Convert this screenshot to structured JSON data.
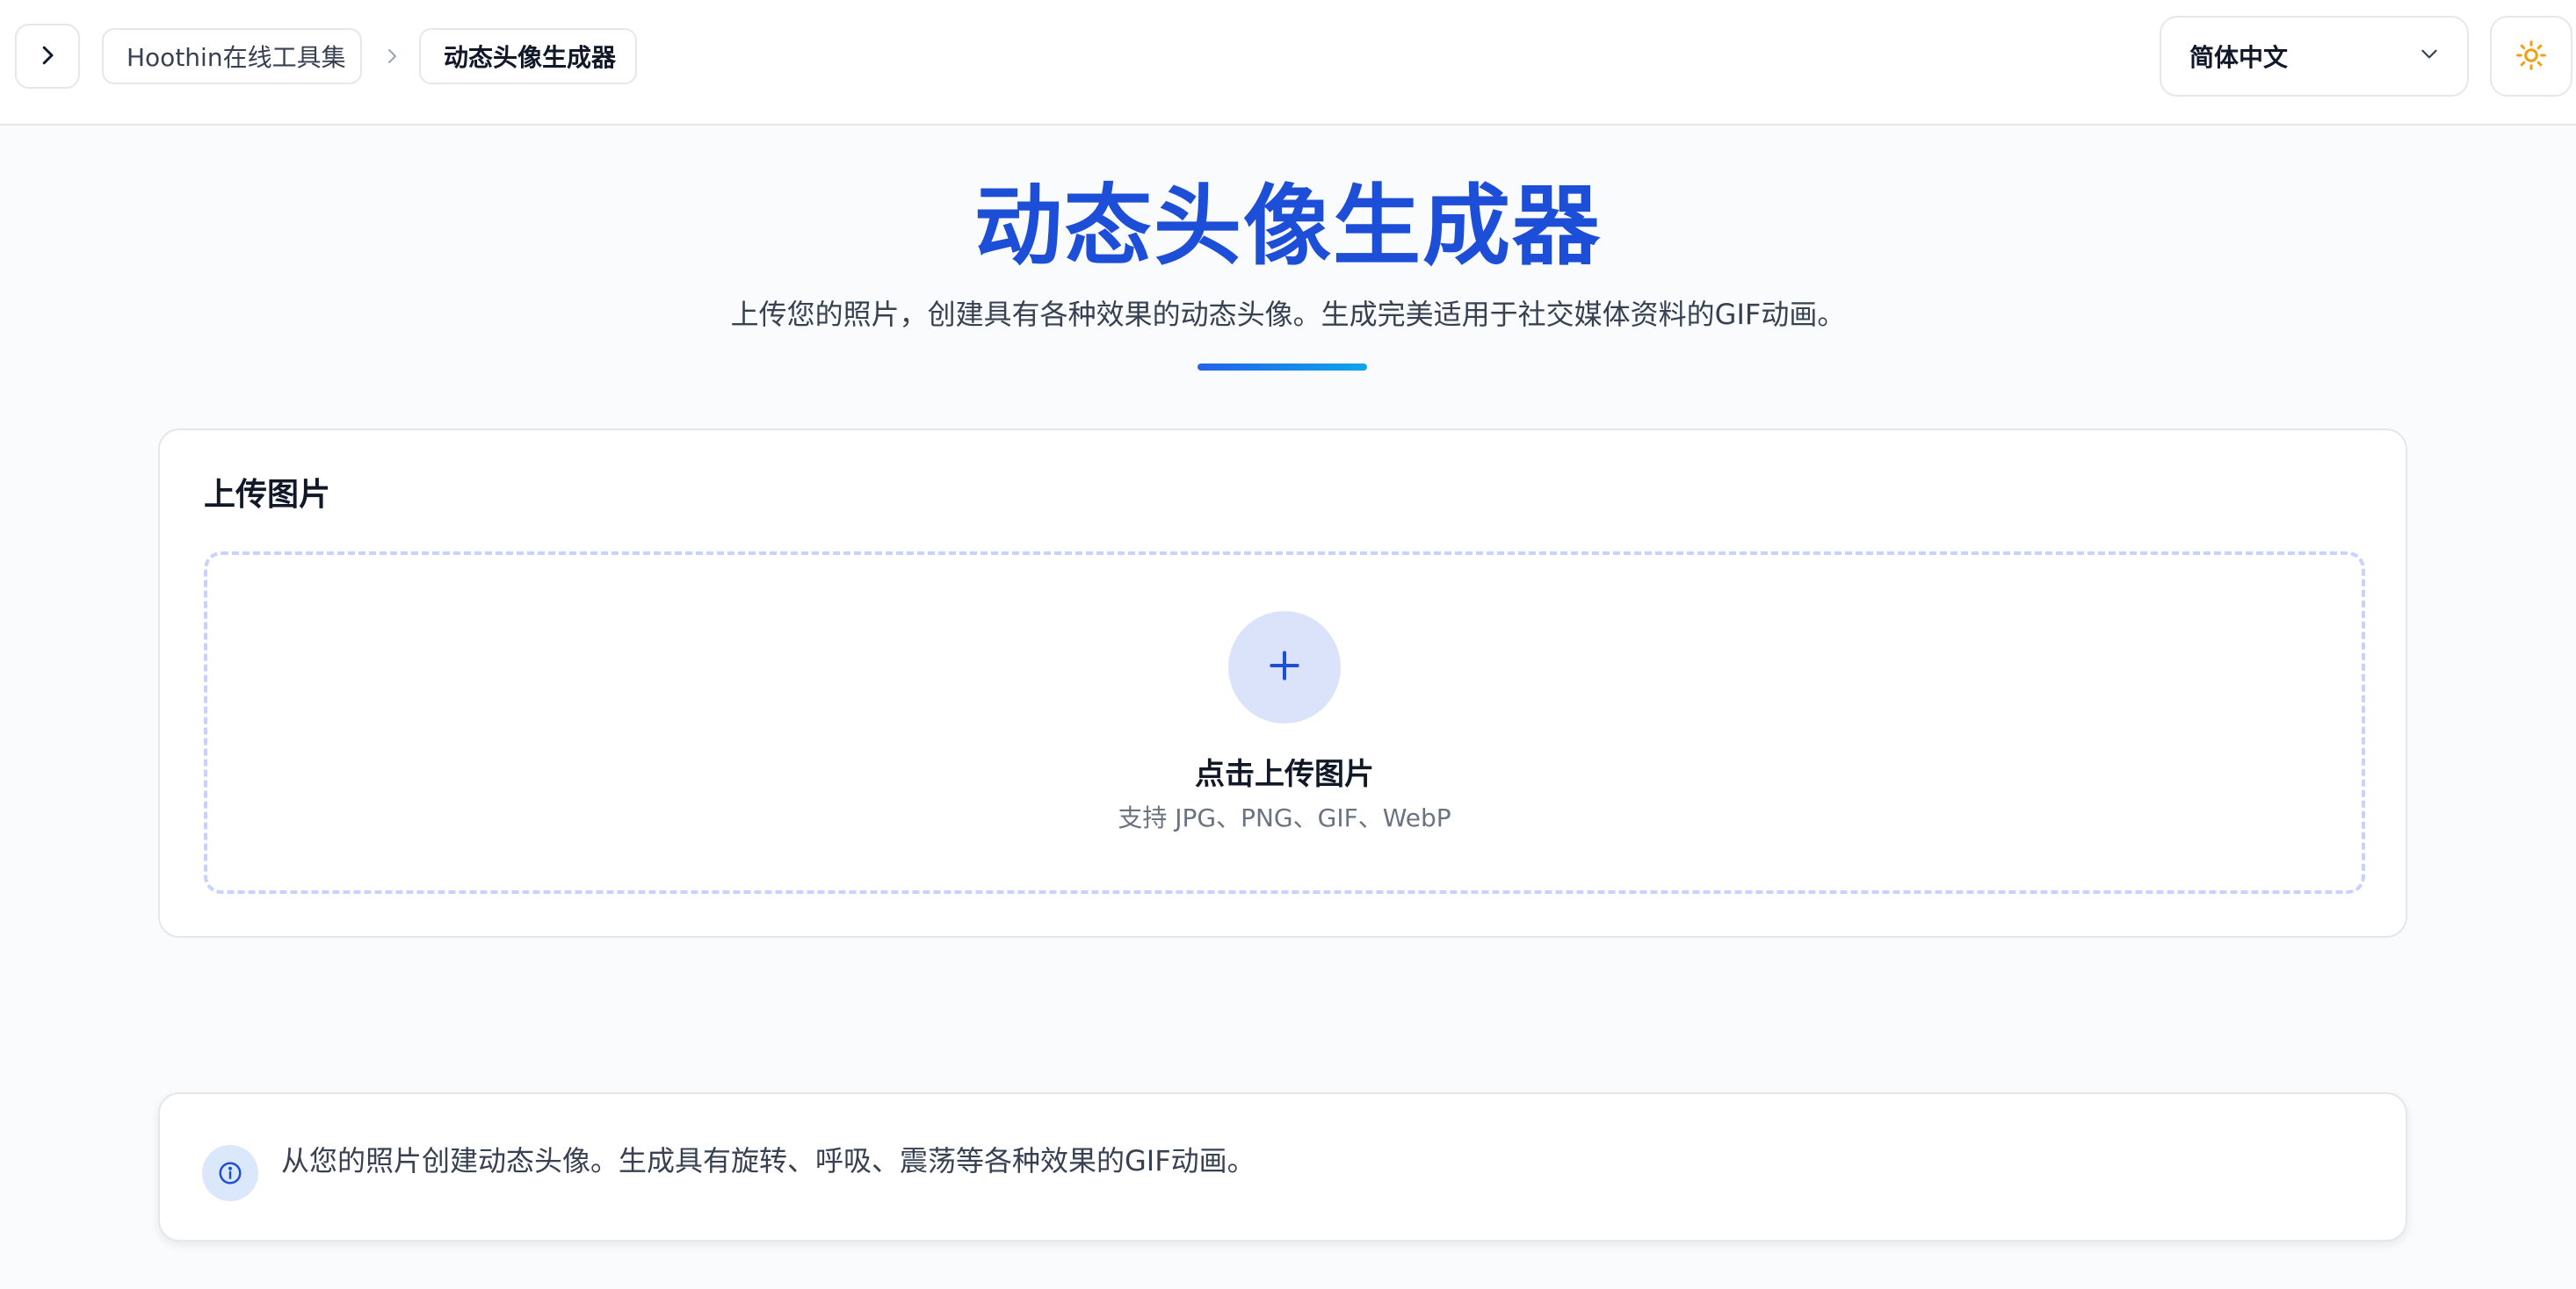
{
  "header": {
    "breadcrumb": {
      "home": "Hoothin在线工具集",
      "current": "动态头像生成器"
    },
    "language": {
      "selected": "简体中文"
    }
  },
  "hero": {
    "title": "动态头像生成器",
    "subtitle": "上传您的照片，创建具有各种效果的动态头像。生成完美适用于社交媒体资料的GIF动画。"
  },
  "upload": {
    "title": "上传图片",
    "dropzone_label": "点击上传图片",
    "dropzone_hint": "支持 JPG、PNG、GIF、WebP"
  },
  "info": {
    "text": "从您的照片创建动态头像。生成具有旋转、呼吸、震荡等各种效果的GIF动画。"
  },
  "icons": {
    "sidebar_toggle": "chevron-right-icon",
    "breadcrumb_separator": "chevron-right-icon",
    "language_dropdown": "chevron-down-icon",
    "theme_toggle": "sun-icon",
    "upload": "plus-icon",
    "info": "info-icon"
  },
  "colors": {
    "accent": "#1d4ed8",
    "theme_icon": "#f59e0b",
    "upload_circle_bg": "#dbe3fb",
    "dropzone_border": "#c7d2fe",
    "info_circle_bg": "#dbe7fb"
  }
}
